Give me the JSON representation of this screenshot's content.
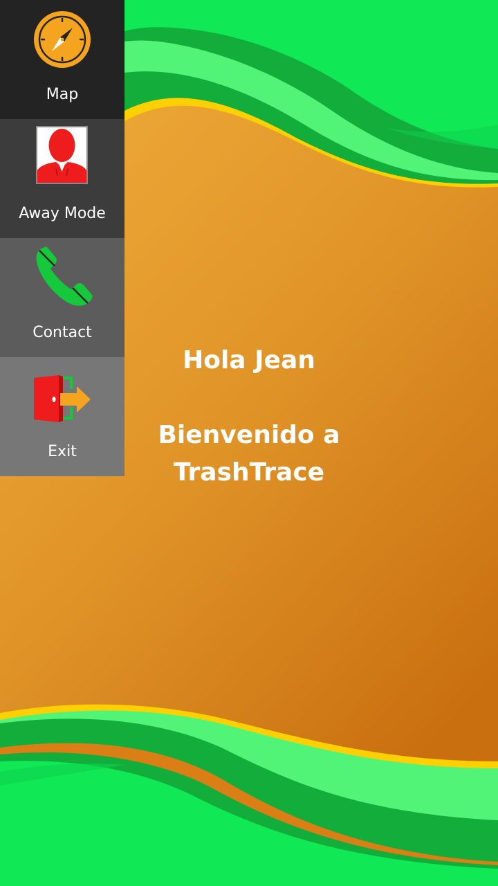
{
  "menu": {
    "items": [
      {
        "label": "Map",
        "icon": "compass-icon"
      },
      {
        "label": "Away Mode",
        "icon": "person-silhouette-icon"
      },
      {
        "label": "Contact",
        "icon": "phone-icon"
      },
      {
        "label": "Exit",
        "icon": "exit-door-icon"
      }
    ]
  },
  "main": {
    "greeting": "Hola Jean",
    "welcome_line1": "Bienvenido a",
    "welcome_line2": "TrashTrace"
  },
  "colors": {
    "background_orange": "#e49a2a",
    "wave_green": "#10e855",
    "wave_dark_green": "#12ad3a",
    "wave_light_green": "#52f477",
    "wave_yellow": "#ffd000",
    "icon_orange": "#f4a41f",
    "icon_red": "#ee1c1c",
    "icon_phone_green": "#16c93c"
  }
}
